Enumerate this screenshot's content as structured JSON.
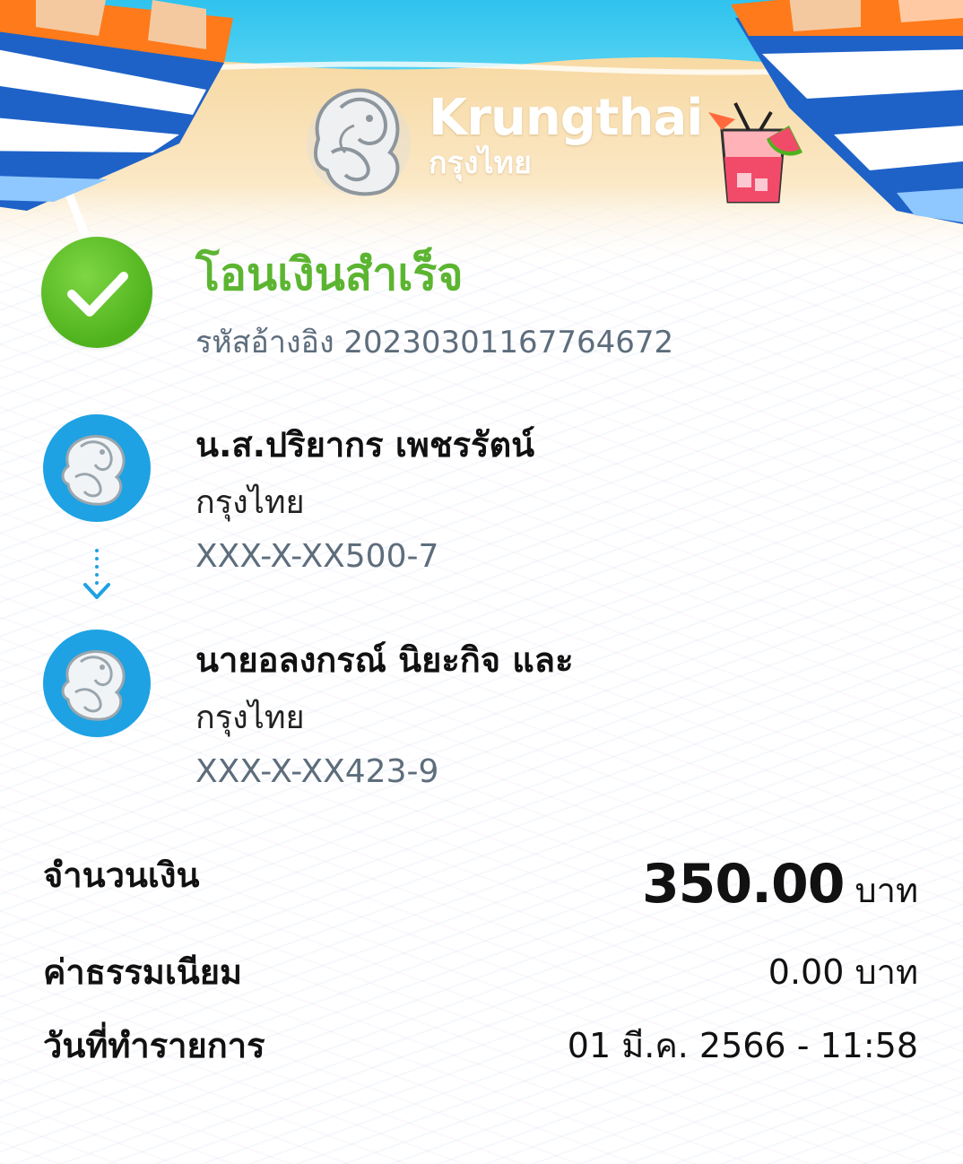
{
  "header": {
    "brand_en": "Krungthai",
    "brand_th": "กรุงไทย",
    "icons": [
      "krungthai-bird-logo",
      "beach-umbrella",
      "drink-glass"
    ]
  },
  "status": {
    "icon": "check-icon",
    "title": "โอนเงินสำเร็จ",
    "ref_label": "รหัสอ้างอิง",
    "ref_number": "2023030116776 4672"
  },
  "sender": {
    "name": "น.ส.ปริยากร เพชรรัตน์",
    "bank": "กรุงไทย",
    "account": "XXX-X-XX500-7"
  },
  "receiver": {
    "name": "นายอลงกรณ์ นิยะกิจ และ",
    "bank": "กรุงไทย",
    "account": "XXX-X-XX423-9"
  },
  "details": {
    "amount_label": "จำนวนเงิน",
    "amount_value": "350.00",
    "amount_unit": "บาท",
    "fee_label": "ค่าธรรมเนียม",
    "fee_value": "0.00 บาท",
    "date_label": "วันที่ทำรายการ",
    "date_value": "01 มี.ค. 2566 - 11:58"
  },
  "colors": {
    "success_green": "#5cb531",
    "krungthai_blue": "#1ea2e3",
    "muted_text": "#5d6d7c"
  }
}
